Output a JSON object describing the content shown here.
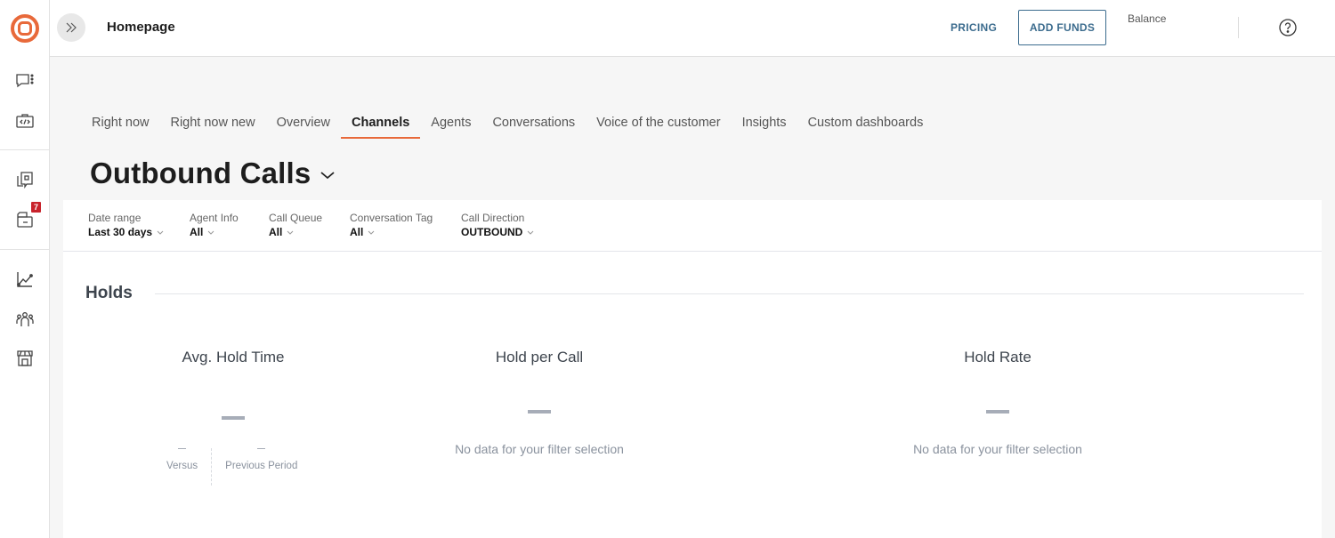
{
  "sidebar": {
    "logo": "orange-target-logo",
    "items": [
      {
        "name": "conversations-icon",
        "label": "Conversations"
      },
      {
        "name": "developer-toolkit-icon",
        "label": "Developer"
      },
      {
        "name": "knowledge-base-icon",
        "label": "Knowledge"
      },
      {
        "name": "inbox-icon",
        "label": "Inbox",
        "badge": "7"
      },
      {
        "name": "analytics-icon",
        "label": "Analytics"
      },
      {
        "name": "team-icon",
        "label": "Team"
      },
      {
        "name": "store-icon",
        "label": "Store"
      }
    ],
    "accent_color": "#e8693a",
    "badge_color": "#c8232c"
  },
  "topbar": {
    "expand_icon": "chevrons-right-icon",
    "page_label": "Homepage",
    "pricing_label": "PRICING",
    "add_funds_label": "ADD FUNDS",
    "balance_label": "Balance",
    "help_icon": "help-circle-icon",
    "link_color": "#3c6c8e"
  },
  "tabs": [
    {
      "label": "Right now",
      "active": false
    },
    {
      "label": "Right now new",
      "active": false
    },
    {
      "label": "Overview",
      "active": false
    },
    {
      "label": "Channels",
      "active": true
    },
    {
      "label": "Agents",
      "active": false
    },
    {
      "label": "Conversations",
      "active": false
    },
    {
      "label": "Voice of the customer",
      "active": false
    },
    {
      "label": "Insights",
      "active": false
    },
    {
      "label": "Custom dashboards",
      "active": false
    }
  ],
  "page_title": "Outbound Calls",
  "filters": [
    {
      "label": "Date range",
      "value": "Last 30 days"
    },
    {
      "label": "Agent Info",
      "value": "All"
    },
    {
      "label": "Call Queue",
      "value": "All"
    },
    {
      "label": "Conversation Tag",
      "value": "All"
    },
    {
      "label": "Call Direction",
      "value": "OUTBOUND"
    }
  ],
  "section": {
    "title": "Holds",
    "metrics": [
      {
        "title": "Avg. Hold Time",
        "value": "—",
        "versus_value": "–",
        "versus_label": "Versus",
        "previous_value": "–",
        "previous_label": "Previous Period"
      },
      {
        "title": "Hold per Call",
        "value": "—",
        "empty_message": "No data for your filter selection"
      },
      {
        "title": "Hold Rate",
        "value": "—",
        "empty_message": "No data for your filter selection"
      }
    ]
  }
}
